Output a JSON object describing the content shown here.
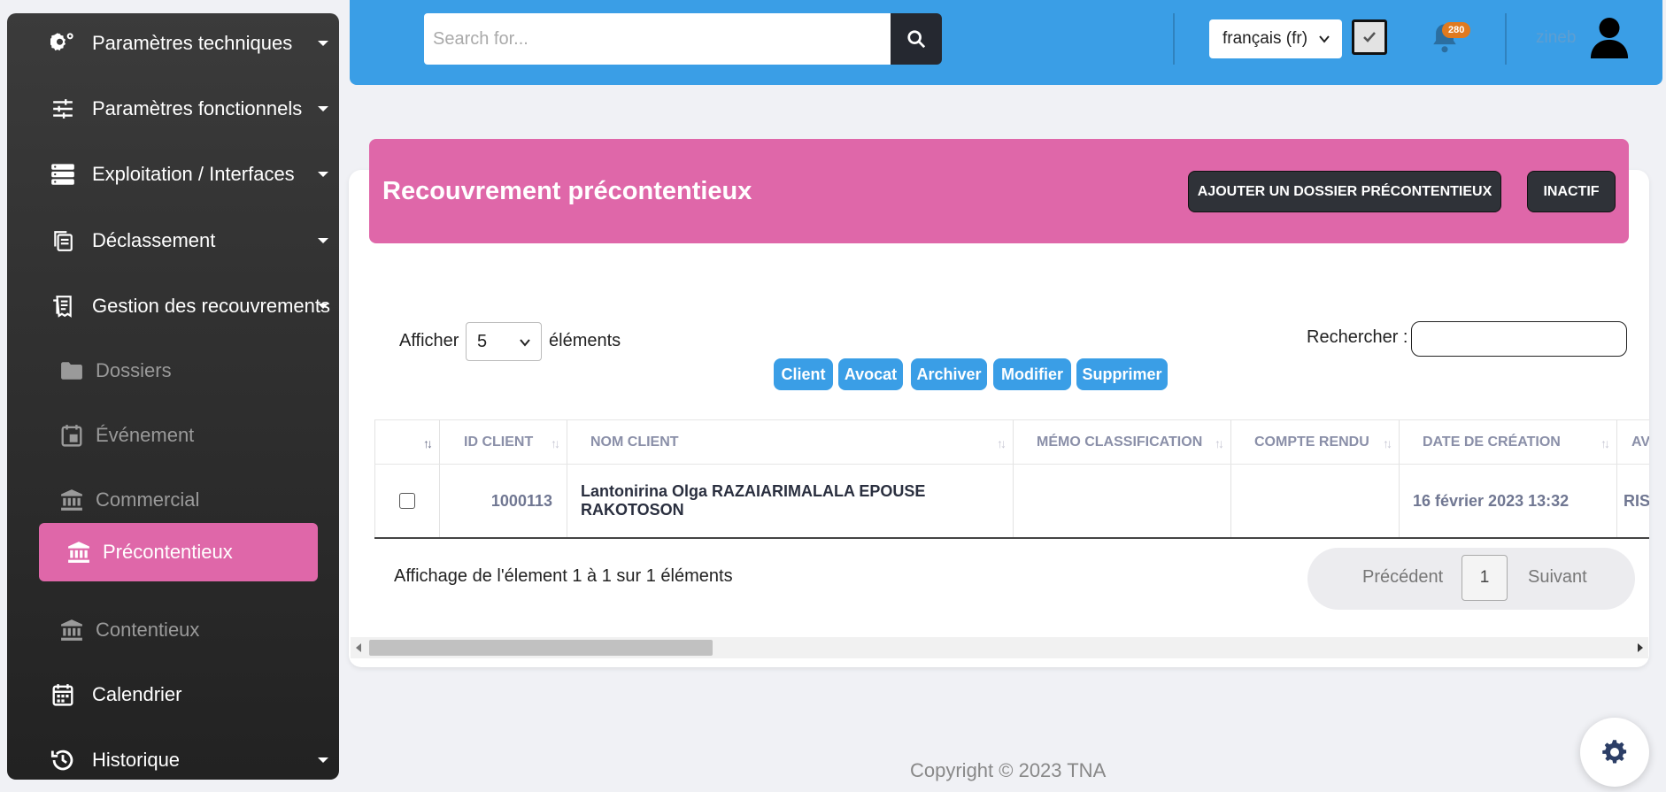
{
  "sidebar": {
    "items": [
      {
        "label": "Paramètres techniques",
        "icon": "gears-icon"
      },
      {
        "label": "Paramètres fonctionnels",
        "icon": "sliders-icon"
      },
      {
        "label": "Exploitation / Interfaces",
        "icon": "server-icon"
      },
      {
        "label": "Déclassement",
        "icon": "files-icon"
      },
      {
        "label": "Gestion des recouvrements",
        "icon": "receipt-icon"
      },
      {
        "label": "Dossiers",
        "icon": "folder-icon"
      },
      {
        "label": "Événement",
        "icon": "calendar-event-icon"
      },
      {
        "label": "Commercial",
        "icon": "bank-icon"
      },
      {
        "label": "Précontentieux",
        "icon": "bank-icon"
      },
      {
        "label": "Contentieux",
        "icon": "bank-icon"
      },
      {
        "label": "Calendrier",
        "icon": "calendar-icon"
      },
      {
        "label": "Historique",
        "icon": "history-icon"
      }
    ]
  },
  "topbar": {
    "search_placeholder": "Search for...",
    "language": "français (fr)",
    "notification_count": "280",
    "username": "zineb"
  },
  "page": {
    "title": "Recouvrement précontentieux",
    "add_button": "AJOUTER UN DOSSIER PRÉCONTENTIEUX",
    "inactive_button": "INACTIF"
  },
  "table_controls": {
    "show_label": "Afficher",
    "page_length": "5",
    "elements_label": "éléments",
    "search_label": "Rechercher :",
    "actions": [
      "Client",
      "Avocat",
      "Archiver",
      "Modifier",
      "Supprimer"
    ]
  },
  "table": {
    "columns": [
      "ID CLIENT",
      "NOM CLIENT",
      "MÉMO CLASSIFICATION",
      "COMPTE RENDU",
      "DATE DE CRÉATION",
      "AVAN"
    ],
    "rows": [
      {
        "id": "1000113",
        "name": "Lantonirina Olga RAZAIARIMALALA EPOUSE RAKOTOSON",
        "memo": "",
        "compte_rendu": "",
        "date": "16 février 2023 13:32",
        "avancement": "RISQU"
      }
    ]
  },
  "footer_table": {
    "info": "Affichage de l'élement 1 à 1 sur 1 éléments",
    "prev": "Précédent",
    "page": "1",
    "next": "Suivant"
  },
  "copyright": "Copyright © 2023 TNA",
  "colors": {
    "accent_blue": "#3a9ee6",
    "accent_pink": "#df67a9",
    "dark": "#2f3238"
  }
}
